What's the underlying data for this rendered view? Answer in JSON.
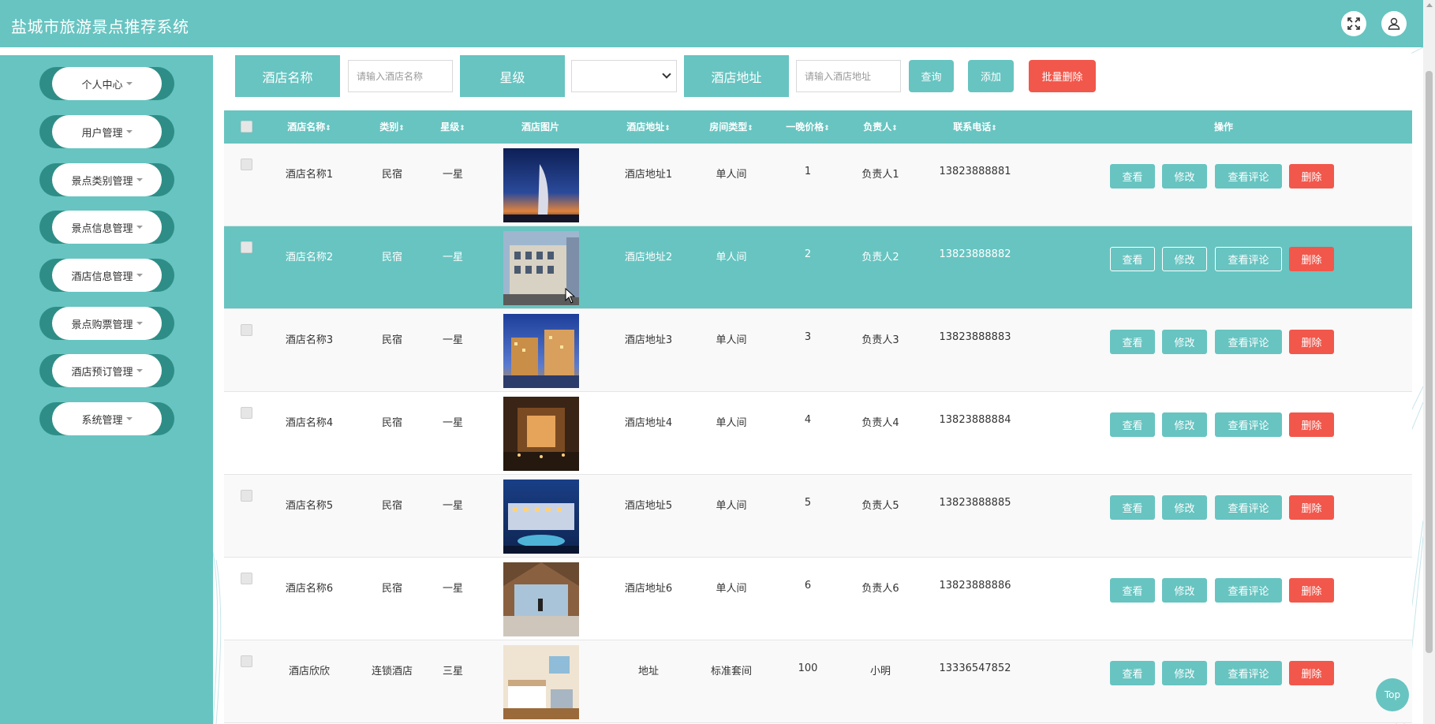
{
  "header": {
    "title": "盐城市旅游景点推荐系统",
    "fullscreen_icon": "expand-icon",
    "user_icon": "user-icon"
  },
  "sidebar": {
    "items": [
      {
        "label": "个人中心"
      },
      {
        "label": "用户管理"
      },
      {
        "label": "景点类别管理"
      },
      {
        "label": "景点信息管理"
      },
      {
        "label": "酒店信息管理"
      },
      {
        "label": "景点购票管理"
      },
      {
        "label": "酒店预订管理"
      },
      {
        "label": "系统管理"
      }
    ]
  },
  "search": {
    "name_label": "酒店名称",
    "name_placeholder": "请输入酒店名称",
    "star_label": "星级",
    "star_value": "",
    "address_label": "酒店地址",
    "address_placeholder": "请输入酒店地址",
    "query_button": "查询",
    "add_button": "添加",
    "batch_delete_button": "批量删除"
  },
  "table": {
    "columns": [
      "酒店名称",
      "类别",
      "星级",
      "酒店图片",
      "酒店地址",
      "房间类型",
      "一晚价格",
      "负责人",
      "联系电话",
      "操作"
    ],
    "sort_glyph": "⇕",
    "rows": [
      {
        "name": "酒店名称1",
        "category": "民宿",
        "star": "一星",
        "address": "酒店地址1",
        "room": "单人间",
        "price": "1",
        "manager": "负责人1",
        "phone": "13823888881"
      },
      {
        "name": "酒店名称2",
        "category": "民宿",
        "star": "一星",
        "address": "酒店地址2",
        "room": "单人间",
        "price": "2",
        "manager": "负责人2",
        "phone": "13823888882"
      },
      {
        "name": "酒店名称3",
        "category": "民宿",
        "star": "一星",
        "address": "酒店地址3",
        "room": "单人间",
        "price": "3",
        "manager": "负责人3",
        "phone": "13823888883"
      },
      {
        "name": "酒店名称4",
        "category": "民宿",
        "star": "一星",
        "address": "酒店地址4",
        "room": "单人间",
        "price": "4",
        "manager": "负责人4",
        "phone": "13823888884"
      },
      {
        "name": "酒店名称5",
        "category": "民宿",
        "star": "一星",
        "address": "酒店地址5",
        "room": "单人间",
        "price": "5",
        "manager": "负责人5",
        "phone": "13823888885"
      },
      {
        "name": "酒店名称6",
        "category": "民宿",
        "star": "一星",
        "address": "酒店地址6",
        "room": "单人间",
        "price": "6",
        "manager": "负责人6",
        "phone": "13823888886"
      },
      {
        "name": "酒店欣欣",
        "category": "连锁酒店",
        "star": "三星",
        "address": "地址",
        "room": "标准套间",
        "price": "100",
        "manager": "小明",
        "phone": "13336547852"
      }
    ],
    "actions": {
      "view": "查看",
      "edit": "修改",
      "review": "查看评论",
      "delete": "删除"
    }
  },
  "top_button": "Top",
  "colors": {
    "primary": "#67c4c1",
    "danger": "#f2574b",
    "sidebar_ring": "#2e8e87"
  }
}
